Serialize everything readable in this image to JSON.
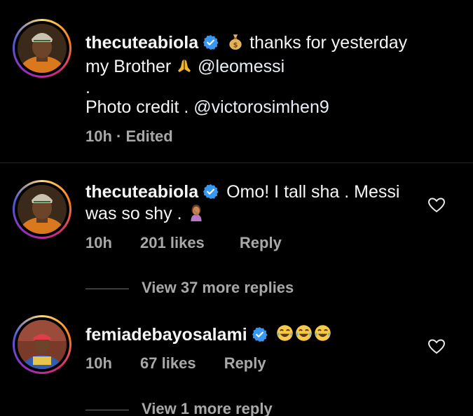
{
  "caption": {
    "username": "thecuteabiola",
    "text_line1_after": "thanks for yesterday",
    "text_line2_start": "my Brother",
    "mention1": "@leomessi",
    "dot": ".",
    "credit_prefix": "Photo credit .",
    "mention2": "@victorosimhen9",
    "time": "10h",
    "separator": "·",
    "edited": "Edited"
  },
  "comments": [
    {
      "username": "thecuteabiola",
      "text_line1": "Omo! I tall sha . Messi",
      "text_line2": "was so shy .",
      "time": "10h",
      "likes": "201 likes",
      "reply_label": "Reply",
      "view_replies": "View 37 more replies"
    },
    {
      "username": "femiadebayosalami",
      "text_line1": "",
      "time": "10h",
      "likes": "67 likes",
      "reply_label": "Reply",
      "view_replies": "View 1 more reply"
    }
  ],
  "colors": {
    "background": "#000000",
    "text": "#f5f5f5",
    "secondary": "#a8a8a8",
    "verified": "#3897f0",
    "divider": "#262626"
  },
  "icons": {
    "verified": "verified-badge-icon",
    "money_bag": "money-bag-emoji",
    "pray": "folded-hands-emoji",
    "facepalm": "woman-facepalming-emoji",
    "laughing": "tears-of-joy-emoji",
    "heart": "heart-outline-icon"
  }
}
